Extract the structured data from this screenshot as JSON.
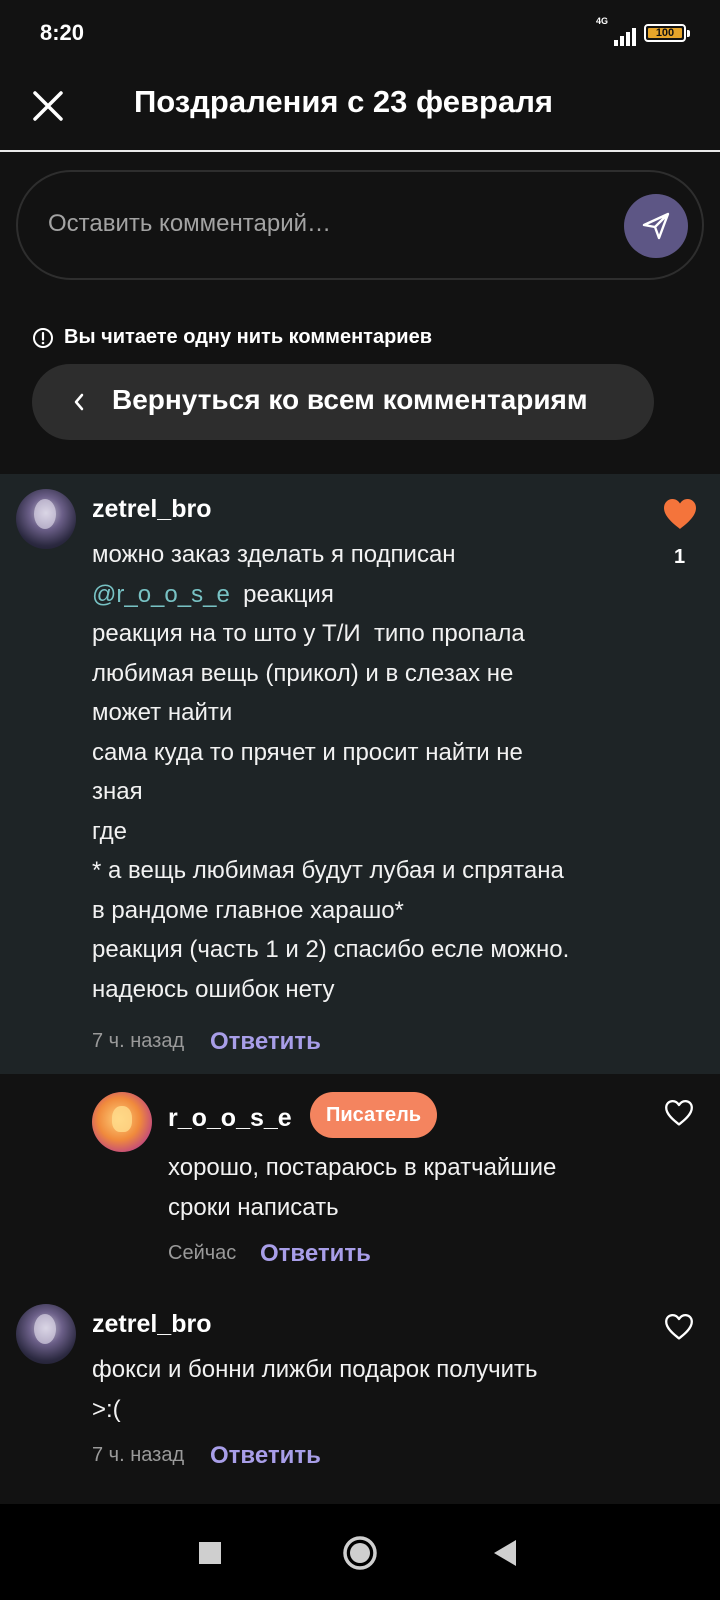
{
  "status": {
    "time": "8:20",
    "network": "4G",
    "battery": "100"
  },
  "header": {
    "title": "Поздраления с 23 февраля"
  },
  "comment_box": {
    "placeholder": "Оставить комментарий…"
  },
  "thread": {
    "notice": "Вы читаете одну нить комментариев",
    "back_label": "Вернуться ко всем комментариям"
  },
  "comments": [
    {
      "author": "zetrel_bro",
      "lines": [
        "можно заказ зделать я подписан",
        "реакция",
        "реакция на то што у Т/И  типо пропала\nлюбимая вещь (прикол) и в слезах не\nможет найти\nсама куда то прячет и просит найти не\nзная\nгде\n* а вещь любимая будут лубая и спрятана\nв рандоме главное харашо*\nреакция (часть 1 и 2) спасибо есле можно.\nнадеюсь ошибок нету"
      ],
      "mention": "@r_o_o_s_e",
      "time": "7 ч. назад",
      "reply": "Ответить",
      "likes": "1",
      "liked": true
    },
    {
      "author": "r_o_o_s_e",
      "badge": "Писатель",
      "text": "хорошо, постараюсь в кратчайшие\nсроки написать",
      "time": "Сейчас",
      "reply": "Ответить"
    },
    {
      "author": "zetrel_bro",
      "text": "фокси и бонни лижби подарок получить\n>:(",
      "time": "7 ч. назад",
      "reply": "Ответить"
    }
  ],
  "colors": {
    "accent": "#a89ee8",
    "like": "#f4743b",
    "badge": "#f4845f",
    "mention": "#78c2c4"
  }
}
